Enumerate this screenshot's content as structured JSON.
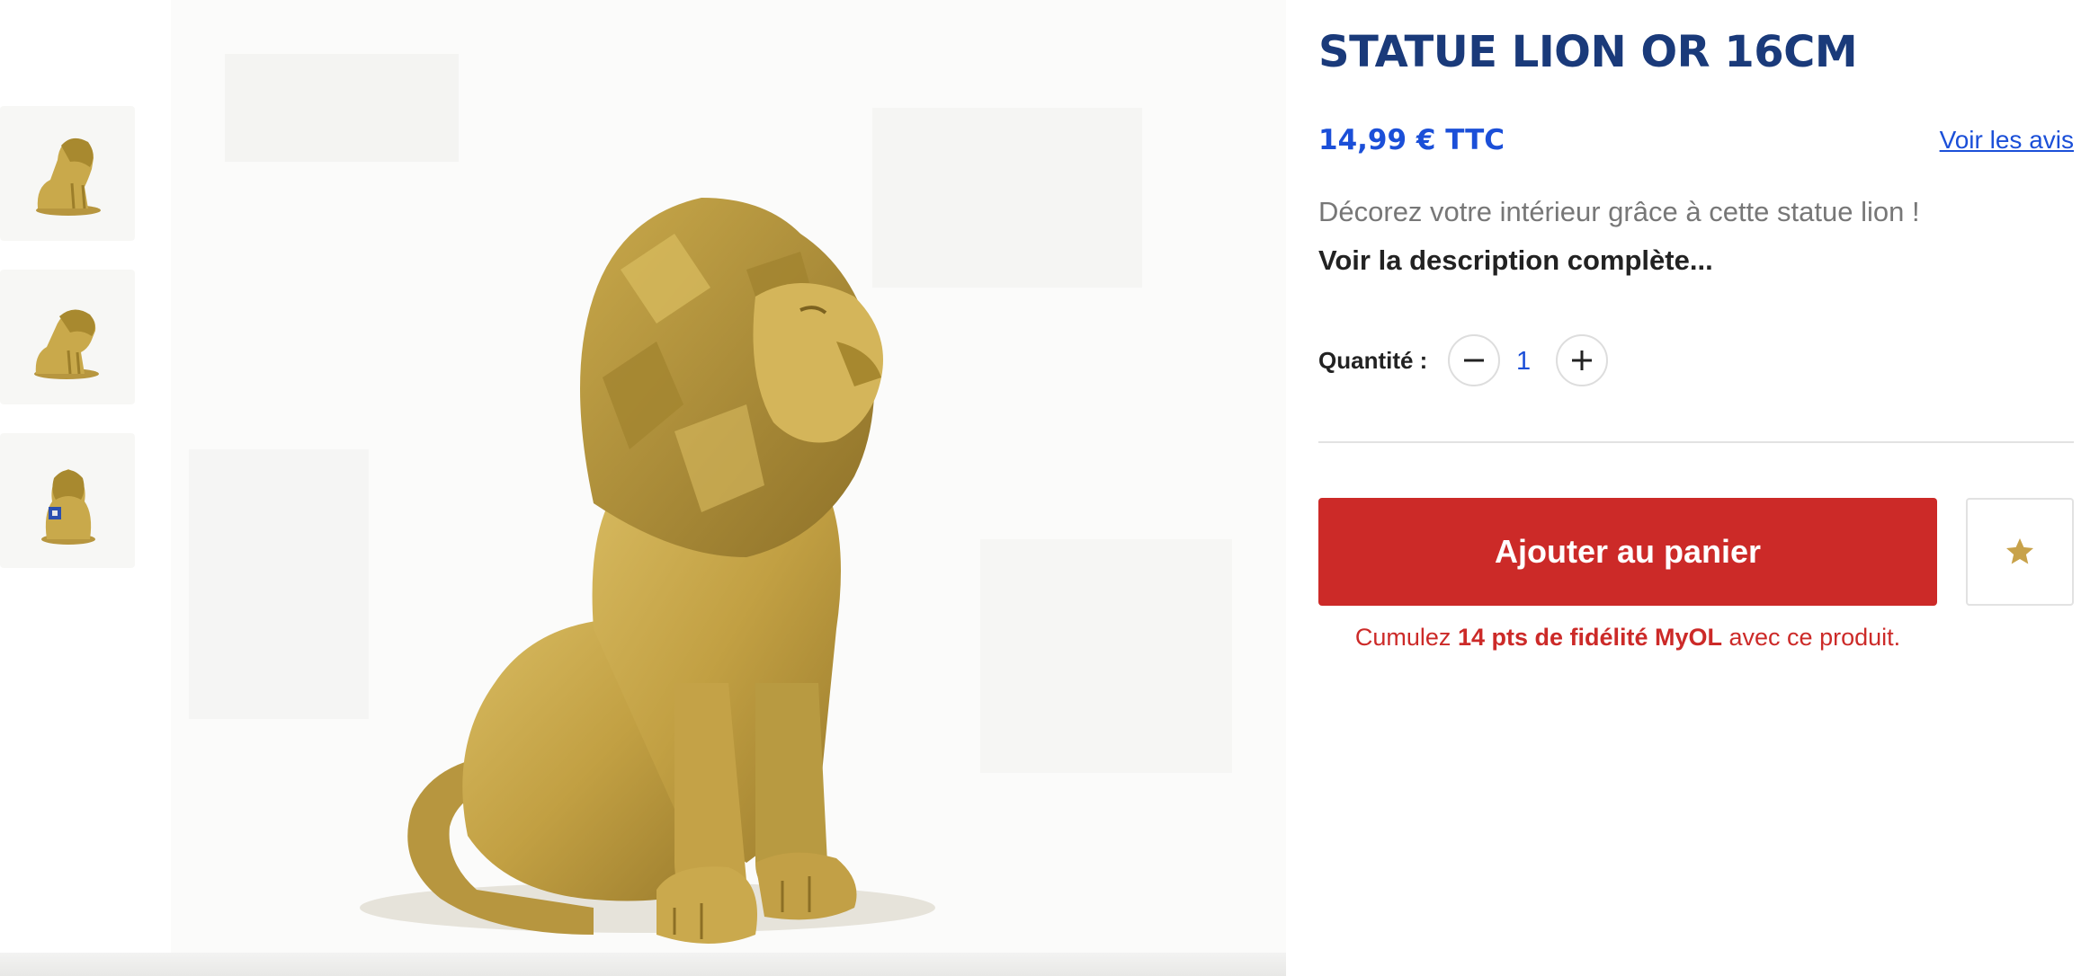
{
  "product": {
    "title": "STATUE LION OR 16CM",
    "price": "14,99 € TTC",
    "reviews_link": "Voir les avis",
    "short_description": "Décorez votre intérieur grâce à cette statue lion !",
    "full_description_link": "Voir la description complète..."
  },
  "quantity": {
    "label": "Quantité :",
    "value": "1"
  },
  "cart": {
    "add_button": "Ajouter au panier"
  },
  "loyalty": {
    "prefix": "Cumulez",
    "points": "14 pts de fidélité MyOL",
    "suffix": "avec ce produit."
  },
  "icons": {
    "minus": "minus-icon",
    "plus": "plus-icon",
    "favorite": "star-icon"
  },
  "colors": {
    "title": "#1a3a7a",
    "price": "#1b4fd8",
    "cart_button": "#cc2a28",
    "favorite_star": "#c8a24a",
    "statue_gold": "#c9a94b"
  }
}
